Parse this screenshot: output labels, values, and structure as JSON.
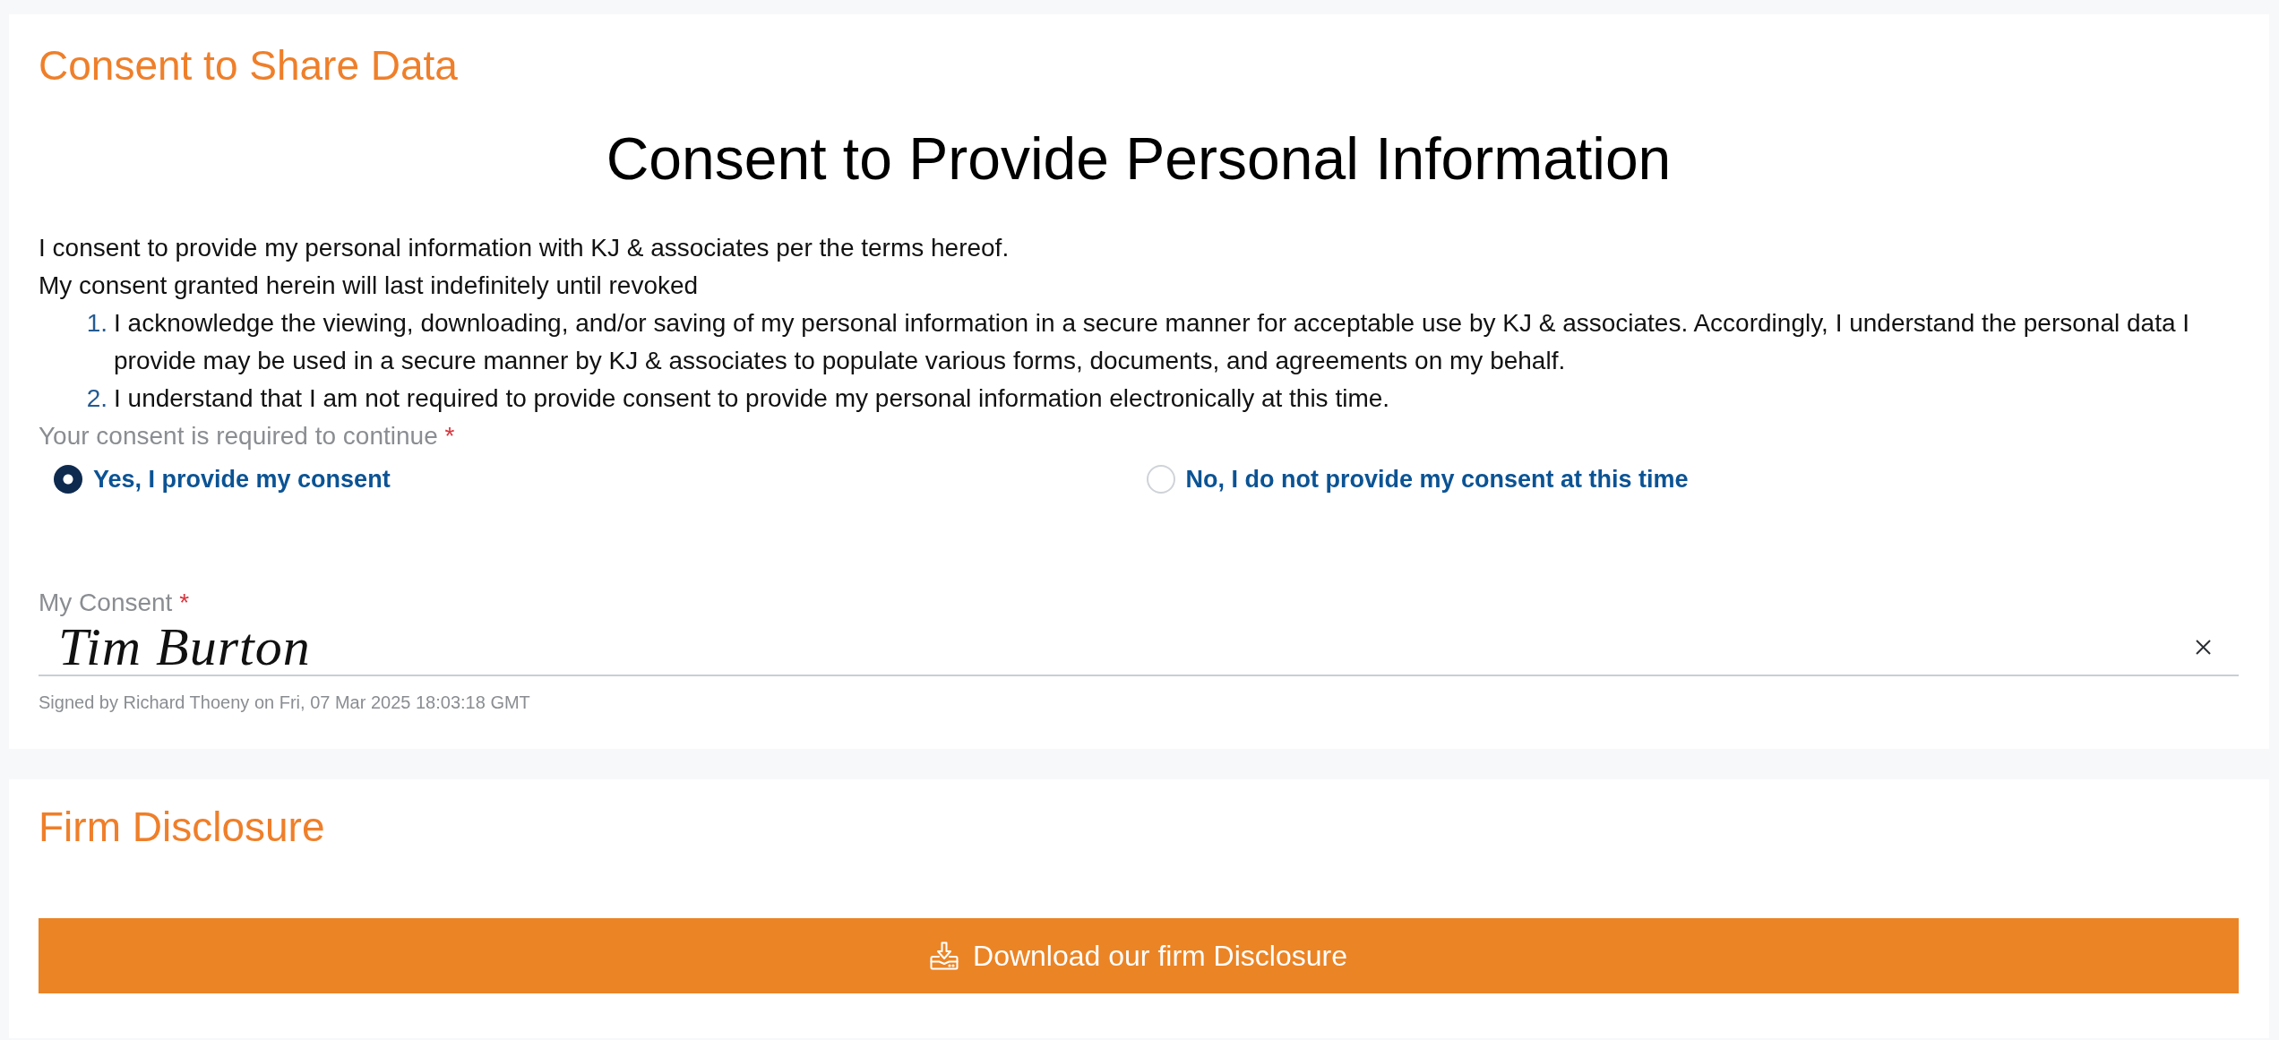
{
  "consent_section": {
    "title": "Consent to Share Data",
    "heading": "Consent to Provide Personal Information",
    "intro": [
      "I consent to provide my personal information with KJ & associates per the terms hereof.",
      "My consent granted herein will last indefinitely until revoked"
    ],
    "terms": [
      {
        "number": "1.",
        "text": "I acknowledge the viewing, downloading, and/or saving of my personal information in a secure manner for acceptable use by KJ & associates. Accordingly, I understand the personal data I provide may be used in a secure manner by KJ & associates to populate various forms, documents, and agreements on my behalf."
      },
      {
        "number": "2.",
        "text": "I understand that I am not required to provide consent to provide my personal information electronically at this time."
      }
    ],
    "consent_question": {
      "label": "Your consent is required to continue",
      "required_mark": "*",
      "options": [
        {
          "label": "Yes, I provide my consent",
          "selected": true
        },
        {
          "label": "No, I do not provide my consent at this time",
          "selected": false
        }
      ]
    },
    "signature": {
      "label": "My Consent",
      "required_mark": "*",
      "value": "Tim Burton",
      "signed_note": "Signed by Richard Thoeny on Fri, 07 Mar 2025 18:03:18 GMT"
    }
  },
  "disclosure_section": {
    "title": "Firm Disclosure",
    "button": "Download our firm Disclosure"
  }
}
